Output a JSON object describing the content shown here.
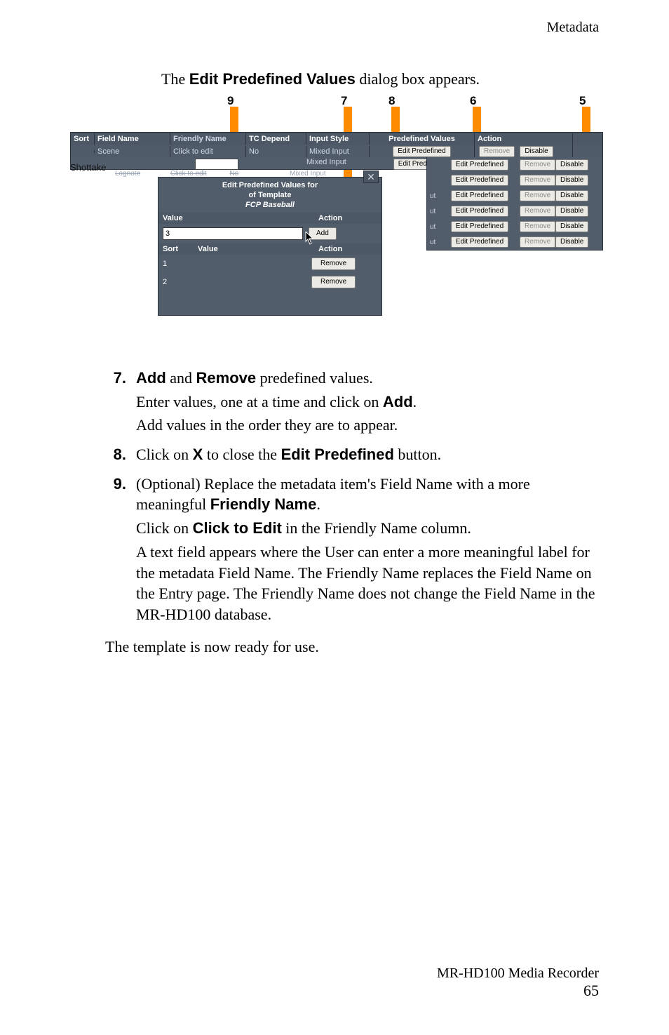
{
  "header": {
    "section": "Metadata"
  },
  "intro": {
    "pre": "The ",
    "bold": "Edit Predefined Values",
    "post": " dialog box appears."
  },
  "callouts": {
    "n5": "5",
    "n6": "6",
    "n7": "7",
    "n8": "8",
    "n9": "9"
  },
  "table": {
    "headers": {
      "sort": "Sort",
      "field": "Field Name",
      "friendly": "Friendly Name",
      "tc": "TC Depend",
      "input": "Input Style",
      "pred": "Predefined Values",
      "action": "Action"
    },
    "row_scene": {
      "field": "Scene",
      "friendly": "Click to edit",
      "tc": "No",
      "input": "Mixed Input"
    },
    "shottake": "Shottake",
    "lognote": "Lognote",
    "faded_friendly": "Click to edit",
    "faded_tc": "No",
    "mixed": "Mixed Input",
    "edit_predefined": "Edit Predefined",
    "remove": "Remove",
    "disable": "Disable",
    "ut": "ut"
  },
  "right_rows": [
    {
      "edit": true
    },
    {
      "edit": true
    },
    {
      "edit": true
    },
    {
      "edit": true
    },
    {
      "edit": true
    },
    {
      "edit": true
    },
    {
      "edit": true
    }
  ],
  "epv": {
    "title_l1": "Edit Predefined Values for",
    "title_l2": "of Template",
    "title_l3": "FCP Baseball",
    "value_hdr": "Value",
    "action_hdr": "Action",
    "input_value": "3",
    "add": "Add",
    "sort_hdr": "Sort",
    "rows": [
      {
        "sort": "1",
        "value": "",
        "action": "Remove"
      },
      {
        "sort": "2",
        "value": "",
        "action": "Remove"
      }
    ]
  },
  "list": {
    "7": {
      "p1a": "Add",
      "p1b": " and ",
      "p1c": "Remove",
      "p1d": " predefined values.",
      "p2a": "Enter values, one at a time and click on ",
      "p2b": "Add",
      "p2c": ".",
      "p3": "Add values in the order they are to appear."
    },
    "8": {
      "p1a": "Click on ",
      "p1b": "X",
      "p1c": " to close the ",
      "p1d": "Edit Predefined",
      "p1e": " button."
    },
    "9": {
      "p1a": "(Optional) Replace the metadata item's Field Name with a more meaningful ",
      "p1b": "Friendly Name",
      "p1c": ".",
      "p2a": "Click on ",
      "p2b": "Click to Edit",
      "p2c": " in the Friendly Name column.",
      "p3": "A text field appears where the User can enter a more meaningful label for the metadata Field Name. The Friendly Name replaces the Field Name on the Entry page. The Friendly Name does not change the Field Name in the MR-HD100 database."
    }
  },
  "closing": "The template is now ready for use.",
  "footer": {
    "line1": "MR-HD100 Media Recorder",
    "page": "65"
  }
}
